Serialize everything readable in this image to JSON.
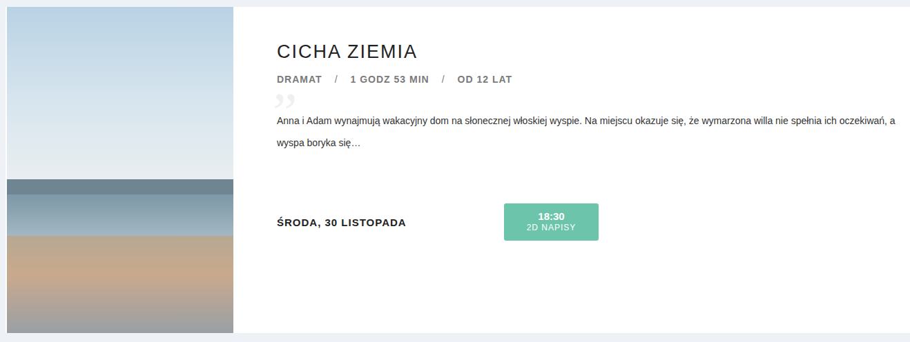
{
  "movie": {
    "title": "CICHA ZIEMIA",
    "meta": [
      "DRAMAT",
      "1 GODZ 53 MIN",
      "OD 12 LAT"
    ],
    "separator": "/",
    "quote_mark": "”",
    "description": "Anna i Adam wynajmują wakacyjny dom na słonecznej włoskiej wyspie. Na miejscu okazuje się, że wymarzona willa nie spełnia ich oczekiwań, a wyspa boryka się…"
  },
  "showings": [
    {
      "day": "ŚRODA, 30 LISTOPADA",
      "times": [
        {
          "time": "18:30",
          "format": "2D NAPISY"
        }
      ]
    }
  ]
}
